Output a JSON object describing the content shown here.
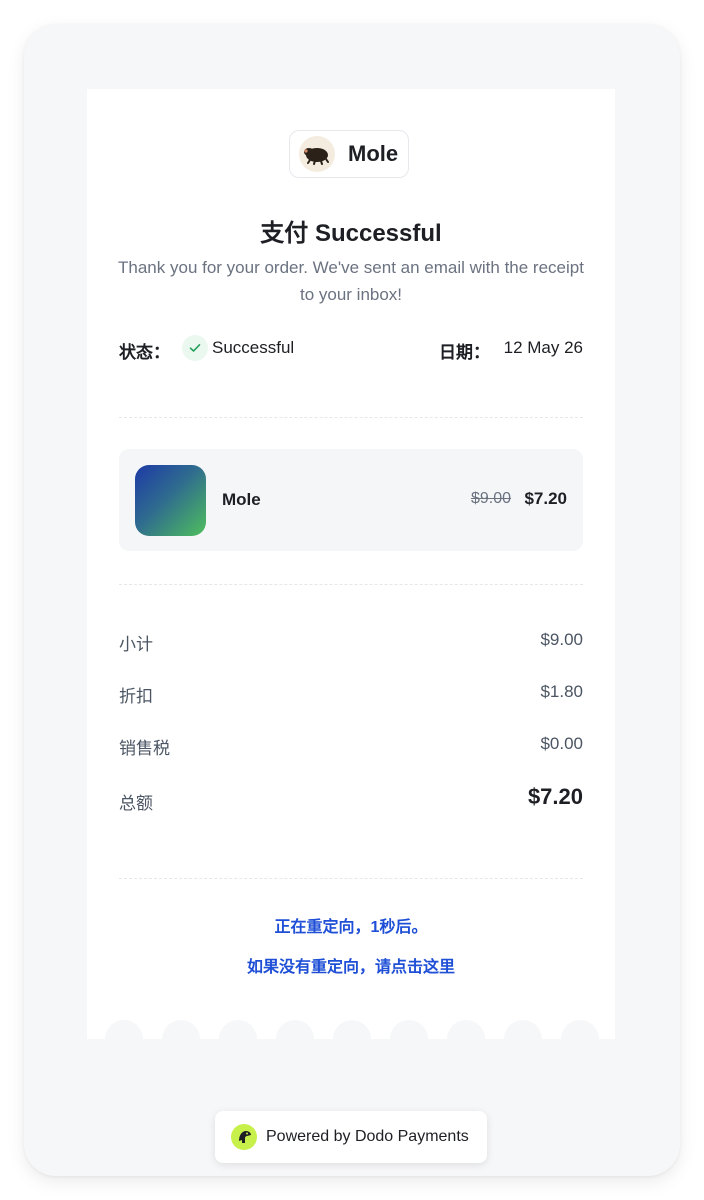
{
  "brand": {
    "name": "Mole",
    "logo_icon": "mole-icon"
  },
  "header": {
    "title": "支付 Successful",
    "subtitle": "Thank you for your order. We've sent an email with the receipt to your inbox!"
  },
  "meta": {
    "status_label": "状态：",
    "status_value": "Successful",
    "status_icon": "check-icon",
    "date_label": "日期：",
    "date_value": "12 May 26"
  },
  "product": {
    "name": "Mole",
    "original_price": "$9.00",
    "price": "$7.20"
  },
  "summary": {
    "subtotal_label": "小计",
    "subtotal_value": "$9.00",
    "discount_label": "折扣",
    "discount_value": "$1.80",
    "tax_label": "销售税",
    "tax_value": "$0.00",
    "total_label": "总额",
    "total_value": "$7.20"
  },
  "redirect": {
    "countdown_text": "正在重定向，1秒后。",
    "link_text": "如果没有重定向，请点击这里"
  },
  "footer": {
    "powered_by": "Powered by Dodo Payments",
    "logo_icon": "dodo-payments-icon"
  },
  "colors": {
    "background": "#f6f7f9",
    "card": "#ffffff",
    "text": "#1e1f24",
    "muted": "#6b7280",
    "link": "#1f4fd6",
    "success": "#ebf8ef",
    "dodo_accent": "#c7f04a"
  }
}
